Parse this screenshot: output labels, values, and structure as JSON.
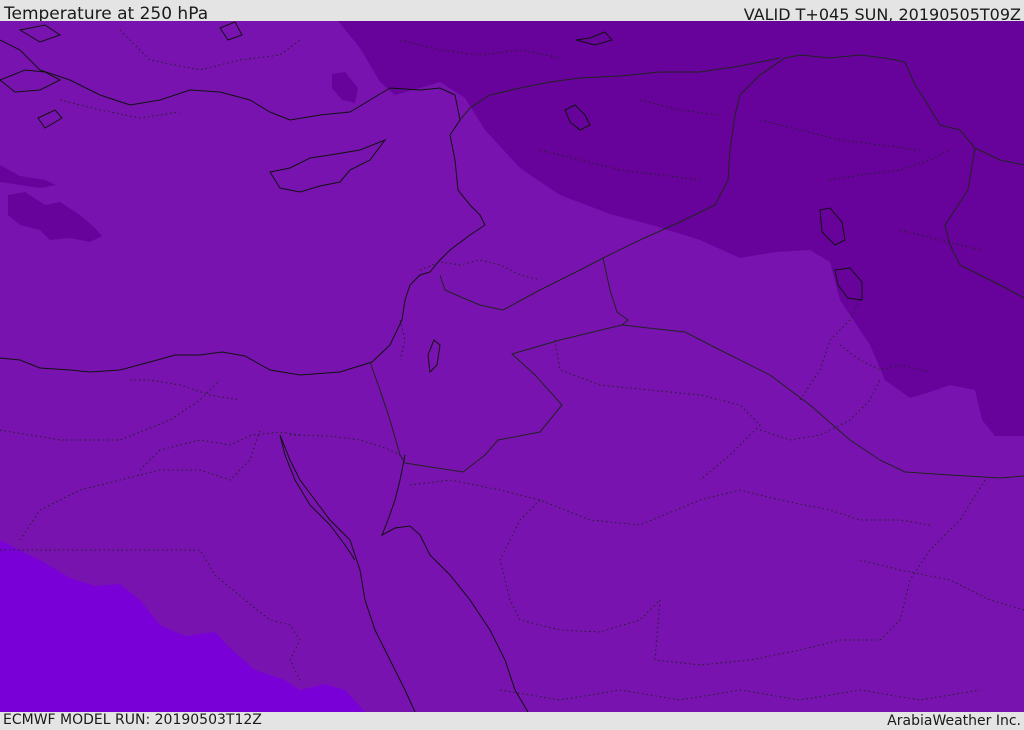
{
  "header": {
    "title": "Temperature at 250 hPa",
    "valid": "VALID T+045 SUN, 20190505T09Z"
  },
  "footer": {
    "model_run": "ECMWF MODEL RUN: 20190503T12Z",
    "credit": "ArabiaWeather Inc."
  },
  "map": {
    "colors": {
      "base": "#7913b0",
      "cold": "#67039b",
      "colder": "#5f0a8e",
      "warm": "#7a00d8",
      "coast": "#111111",
      "border": "#222222"
    }
  }
}
